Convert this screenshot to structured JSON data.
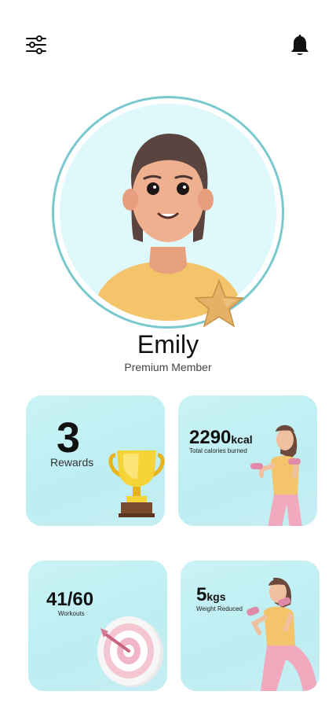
{
  "icons": {
    "filter": "sliders-icon",
    "notifications": "bell-icon",
    "badge": "star-icon"
  },
  "profile": {
    "name": "Emily",
    "membership": "Premium Member"
  },
  "stats": {
    "rewards": {
      "value": "3",
      "label": "Rewards"
    },
    "calories": {
      "value": "2290",
      "unit": "kcal",
      "label": "Total calories burned"
    },
    "workouts": {
      "value": "41/60",
      "label": "Workouts"
    },
    "weight": {
      "value": "5",
      "unit": "kgs",
      "label": "Weight Reduced"
    }
  },
  "colors": {
    "accent": "#79c9cf",
    "card": "#c9f3f6",
    "avatar_bg": "#dff8fb"
  }
}
